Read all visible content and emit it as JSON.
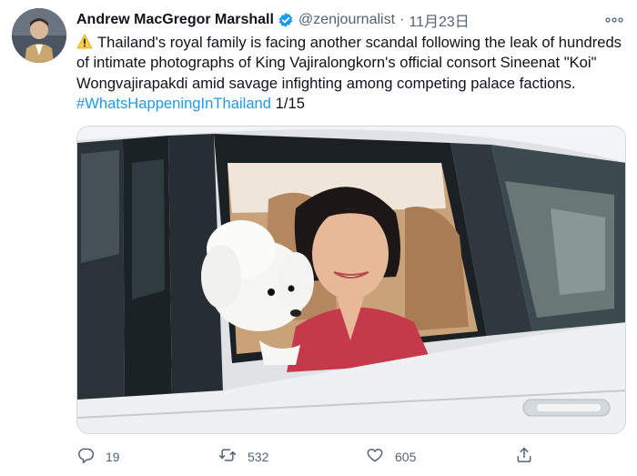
{
  "author": {
    "name": "Andrew MacGregor Marshall",
    "handle": "@zenjournalist",
    "date": "11月23日"
  },
  "tweet": {
    "text_main": "Thailand's royal family is facing another scandal following the leak of hundreds of intimate photographs of King Vajiralongkorn's official consort Sineenat \"Koi\" Wongvajirapakdi amid savage infighting among competing palace factions. ",
    "hashtag": "#WhatsHappeningInThailand",
    "thread_count": " 1/15"
  },
  "actions": {
    "reply_count": "19",
    "retweet_count": "532",
    "like_count": "605"
  },
  "icons": {
    "verified": "verified-badge-icon",
    "warning": "warning-icon",
    "more": "more-icon",
    "reply": "reply-icon",
    "retweet": "retweet-icon",
    "like": "like-icon",
    "share": "share-icon"
  },
  "colors": {
    "accent": "#1d9bf0",
    "muted_text": "#536471",
    "text": "#0f1419"
  }
}
